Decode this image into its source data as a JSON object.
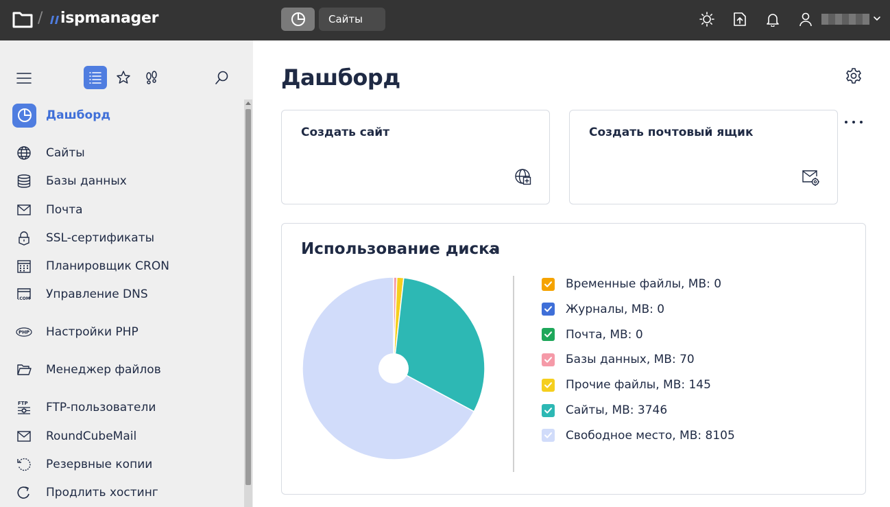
{
  "topbar": {
    "logo_text": "ispmanager",
    "logo_sep": "/",
    "sites_button": "Сайты",
    "icons": [
      "dashboard-icon",
      "theme-toggle-icon",
      "upload-icon",
      "notifications-icon",
      "user-icon",
      "chevron-down-icon"
    ]
  },
  "sidebar": {
    "toolbar_icons": [
      "menu-icon",
      "list-icon",
      "star-icon",
      "footsteps-icon",
      "search-icon"
    ],
    "items": [
      {
        "label": "Дашборд",
        "icon": "dashboard-icon",
        "active": true
      },
      {
        "label": "Сайты",
        "icon": "globe-icon"
      },
      {
        "label": "Базы данных",
        "icon": "database-icon"
      },
      {
        "label": "Почта",
        "icon": "mail-icon"
      },
      {
        "label": "SSL-сертификаты",
        "icon": "lock-icon"
      },
      {
        "label": "Планировщик CRON",
        "icon": "calendar-icon"
      },
      {
        "label": "Управление DNS",
        "icon": "dns-icon"
      },
      {
        "label": "Настройки PHP",
        "icon": "php-icon"
      },
      {
        "label": "Менеджер файлов",
        "icon": "folder-icon"
      },
      {
        "label": "FTP-пользователи",
        "icon": "ftp-icon"
      },
      {
        "label": "RoundCubeMail",
        "icon": "mail-icon"
      },
      {
        "label": "Резервные копии",
        "icon": "backup-icon"
      },
      {
        "label": "Продлить хостинг",
        "icon": "refresh-icon"
      }
    ],
    "active_color": "#4f7de0"
  },
  "main": {
    "title": "Дашборд",
    "cards": [
      {
        "title": "Создать сайт",
        "icon": "globe-plus-icon"
      },
      {
        "title": "Создать почтовый ящик",
        "icon": "mail-gear-icon"
      }
    ],
    "disk_title": "Использование диска"
  },
  "chart_data": {
    "type": "pie",
    "donut_hole": true,
    "series": [
      {
        "name": "Временные файлы, MB",
        "value": 0,
        "color": "#f5a300",
        "label": "Временные файлы, MB: 0"
      },
      {
        "name": "Журналы, MB",
        "value": 0,
        "color": "#3f6fd8",
        "label": "Журналы, MB: 0"
      },
      {
        "name": "Почта, MB",
        "value": 0,
        "color": "#1ea75a",
        "label": "Почта, MB: 0"
      },
      {
        "name": "Базы данных, MB",
        "value": 70,
        "color": "#f59aa8",
        "label": "Базы данных, MB: 70"
      },
      {
        "name": "Прочие файлы, MB",
        "value": 145,
        "color": "#f5cf1e",
        "label": "Прочие файлы, MB: 145"
      },
      {
        "name": "Сайты, MB",
        "value": 3746,
        "color": "#2db8b4",
        "label": "Сайты, MB: 3746"
      },
      {
        "name": "Свободное место, MB",
        "value": 8105,
        "color": "#d1dcfa",
        "label": "Свободное место, MB: 8105"
      }
    ]
  }
}
